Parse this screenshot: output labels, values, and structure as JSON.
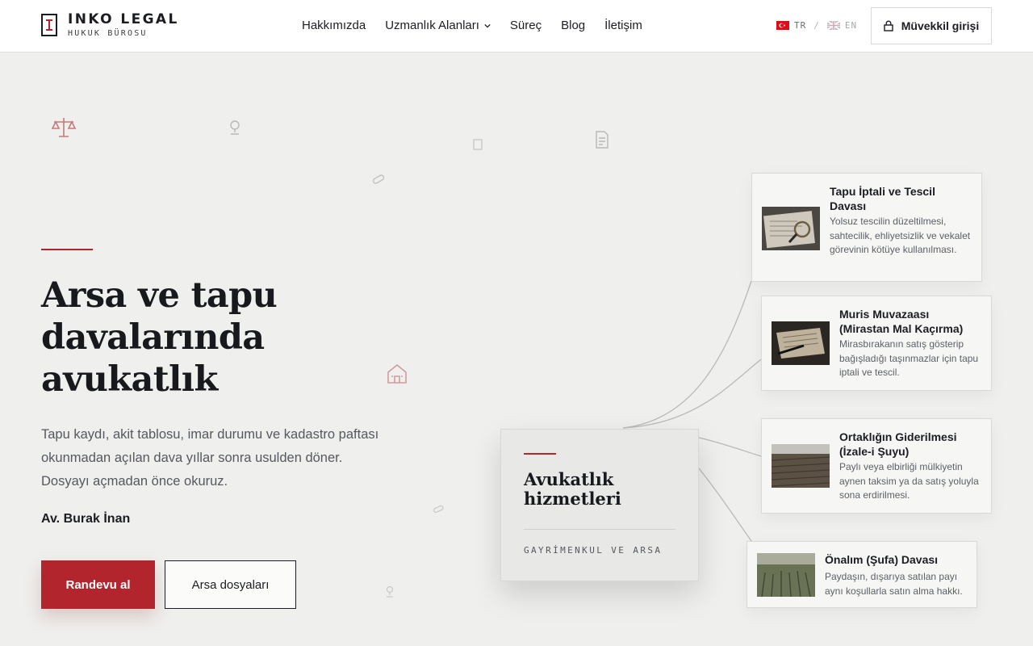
{
  "brand": {
    "name": "INKO LEGAL",
    "subtitle": "HUKUK BÜROSU",
    "accent_color": "#b3252c"
  },
  "nav": {
    "items": [
      {
        "label": "Hakkımızda"
      },
      {
        "label": "Uzmanlık Alanları",
        "has_dropdown": true
      },
      {
        "label": "Süreç"
      },
      {
        "label": "Blog"
      },
      {
        "label": "İletişim"
      }
    ]
  },
  "language": {
    "tr": "TR",
    "separator": "/",
    "en": "EN",
    "active": "TR"
  },
  "login": {
    "label": "Müvekkil girişi",
    "icon": "lock-icon"
  },
  "hero": {
    "title": "Arsa ve tapu davalarında avukatlık",
    "description": "Tapu kaydı, akit tablosu, imar durumu ve kadastro paftası okunmadan açılan dava yıllar sonra usulden döner. Dosyayı açmadan önce okuruz.",
    "author": "Av. Burak İnan",
    "primary_cta": "Randevu al",
    "secondary_cta": "Arsa dosyaları"
  },
  "services_hub": {
    "title": "Avukatlık hizmetleri",
    "tag": "GAYRİMENKUL VE ARSA"
  },
  "services": [
    {
      "title": "Tapu İptali ve Tescil Davası",
      "description": "Yolsuz tescilin düzeltilmesi, sahtecilik, ehliyetsizlik ve vekalet görevinin kötüye kullanılması.",
      "image": "document-magnifier-photo"
    },
    {
      "title": "Muris Muvazaası (Mirastan Mal Kaçırma)",
      "description": "Mirasbırakanın satış gösterip bağışladığı taşınmazlar için tapu iptali ve tescil.",
      "image": "old-book-pen-photo"
    },
    {
      "title": "Ortaklığın Giderilmesi (İzale-i Şuyu)",
      "description": "Paylı veya elbirliği mülkiyetin aynen taksim ya da satış yoluyla sona erdirilmesi.",
      "image": "plowed-field-photo"
    },
    {
      "title": "Önalım (Şufa) Davası",
      "description": "Paydaşın, dışarıya satılan payı aynı koşullarla satın alma hakkı.",
      "image": "crop-field-photo"
    }
  ],
  "decorative_icons": [
    "scales-icon",
    "location-pin-icon",
    "document-icon",
    "file-icon",
    "paperclip-icon",
    "house-icon"
  ]
}
